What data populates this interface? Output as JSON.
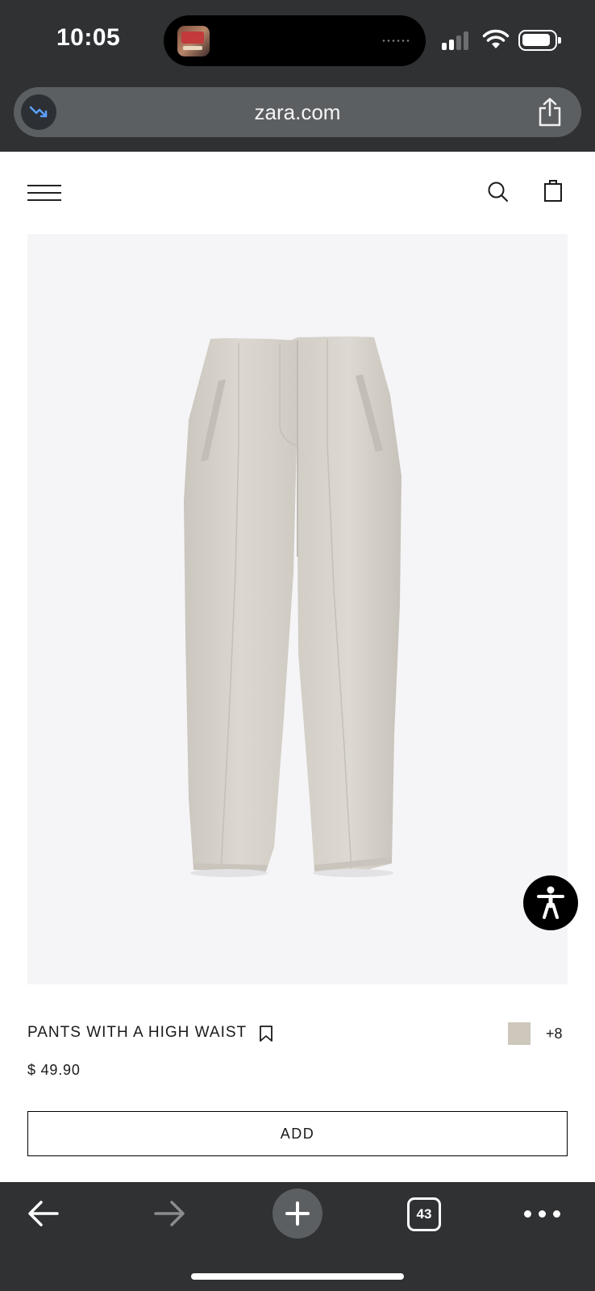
{
  "status_bar": {
    "time": "10:05",
    "battery_icon": "battery-icon",
    "wifi_icon": "wifi-icon",
    "signal_icon": "cellular-signal-icon"
  },
  "browser": {
    "url": "zara.com",
    "tab_count": "43"
  },
  "page": {
    "menu_icon": "hamburger-menu-icon",
    "search_icon": "search-icon",
    "bag_icon": "shopping-bag-icon",
    "product": {
      "name": "PANTS WITH A HIGH WAIST",
      "price": "$ 49.90",
      "swatch_color": "#cdc7bc",
      "more_colors": "+8",
      "add_label": "ADD",
      "image_subject": "pants-product-image"
    },
    "accessibility_icon": "accessibility-icon"
  },
  "colors": {
    "chrome": "#2f3133",
    "url_bar": "#5c5f62",
    "image_bg": "#f5f5f7",
    "pants": "#d8d4cd"
  }
}
